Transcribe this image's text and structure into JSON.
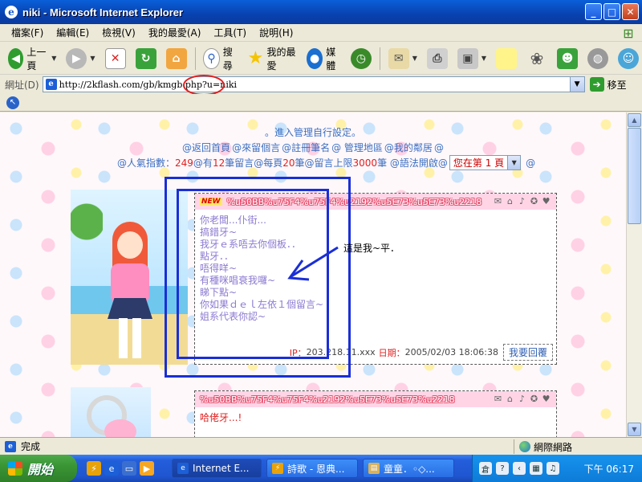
{
  "window": {
    "title": "niki - Microsoft Internet Explorer"
  },
  "menu": [
    "檔案(F)",
    "編輯(E)",
    "檢視(V)",
    "我的最愛(A)",
    "工具(T)",
    "說明(H)"
  ],
  "toolbar": {
    "back": "上一頁",
    "search": "搜尋",
    "favorites": "我的最愛",
    "media": "媒體"
  },
  "address": {
    "label": "網址(D)",
    "url": "http://2kflash.com/gb/kmgb.php?u=niki",
    "go": "移至"
  },
  "content": {
    "nav1": "。進入管理自行設定。",
    "nav2": [
      "@返回首頁",
      "@來留個言",
      "@註冊筆名",
      "@ 管理地區",
      "@我的鄰居",
      "@"
    ],
    "stats": {
      "prefix": "@人氣指數：",
      "popularity": "249",
      "p2": "@有",
      "count": "12",
      "p3": "筆留言@每頁",
      "per_page": "20",
      "p4": "筆@留言上限",
      "limit": "3000",
      "p5": "筆 @語法開啟@",
      "page_select": "您在第 1 頁",
      "suffix": "@"
    },
    "entry1": {
      "badge": "NEW",
      "name": "%u50BB%u75F4%u75F4%u2192%u5E73%u5E73%u2218",
      "lines": [
        "你老闆...仆街...",
        "搞錯牙~",
        "我牙ｅ系唔去你個板．．",
        "點牙．．",
        "唔得咩~",
        "有種咪唱衰我囉~",
        "睇下點~",
        "你如果ｄｅｌ左依１個留言~",
        "姐系代表你認~"
      ],
      "ip_label": "IP：",
      "ip": "203.218.11.xxx",
      "date_label": "日期：",
      "date": "2005/02/03 18:06:38",
      "reply": "我要回覆"
    },
    "annotation": "這是我~平．",
    "entry2": {
      "name": "%u50BB%u75F4%u75F4%u2192%u5E73%u5E73%u2218",
      "lines": [
        "哈佬牙...!"
      ]
    }
  },
  "status": {
    "text": "完成",
    "zone": "網際網路"
  },
  "taskbar": {
    "start": "開始",
    "tasks": [
      "Internet E...",
      "詩歌 - 恩典...",
      "童童．◦◇..."
    ],
    "clock": "下午 06:17"
  }
}
